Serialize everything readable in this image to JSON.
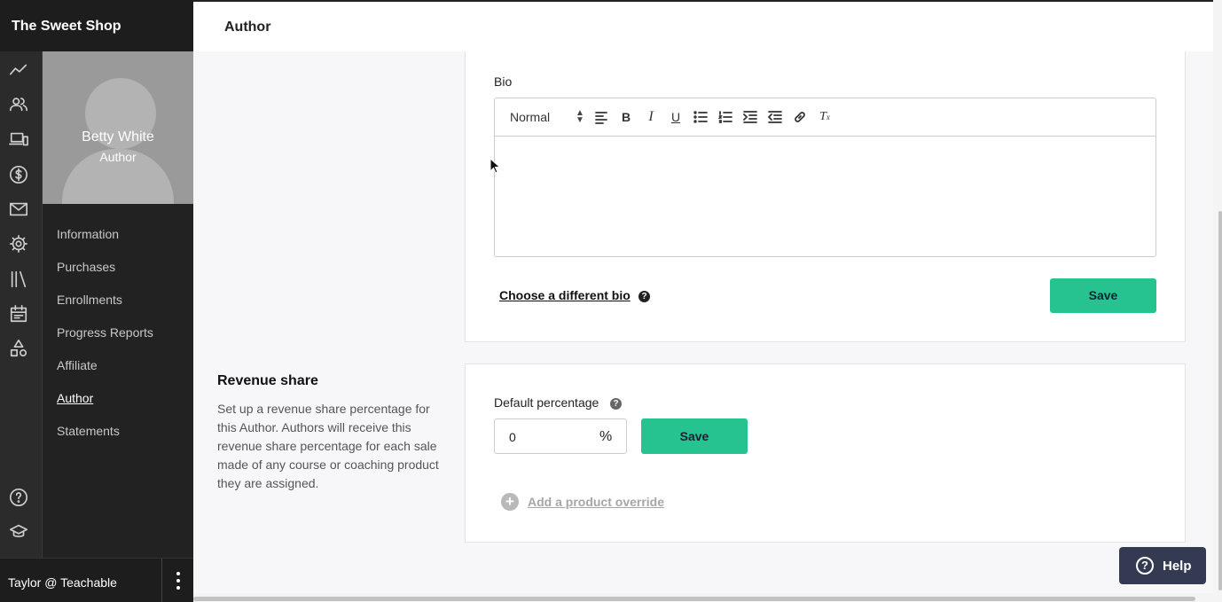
{
  "app": {
    "brand": "The Sweet Shop"
  },
  "header": {
    "title": "Author"
  },
  "profile": {
    "name": "Betty White",
    "role": "Author"
  },
  "subnav": {
    "items": [
      {
        "label": "Information"
      },
      {
        "label": "Purchases"
      },
      {
        "label": "Enrollments"
      },
      {
        "label": "Progress Reports"
      },
      {
        "label": "Affiliate"
      },
      {
        "label": "Author",
        "active": true
      },
      {
        "label": "Statements"
      }
    ]
  },
  "rail_icons": [
    "analytics-icon",
    "users-icon",
    "devices-icon",
    "dollar-icon",
    "mail-icon",
    "gear-icon",
    "library-icon",
    "calendar-icon",
    "shapes-icon",
    "help-circle-icon",
    "graduation-cap-icon"
  ],
  "user": {
    "label": "Taylor @ Teachable"
  },
  "bio": {
    "label": "Bio",
    "format_select": "Normal",
    "content": "",
    "choose_link": "Choose a different bio",
    "save_label": "Save"
  },
  "revenue_share": {
    "title": "Revenue share",
    "description": "Set up a revenue share percentage for this Author. Authors will receive this revenue share percentage for each sale made of any course or coaching product they are assigned.",
    "default_label": "Default percentage",
    "percentage_value": "0",
    "unit": "%",
    "save_label": "Save",
    "add_override": "Add a product override"
  },
  "help": {
    "label": "Help"
  },
  "colors": {
    "accent": "#26c28f",
    "sidebar": "#222222",
    "help_button": "#343a52"
  }
}
